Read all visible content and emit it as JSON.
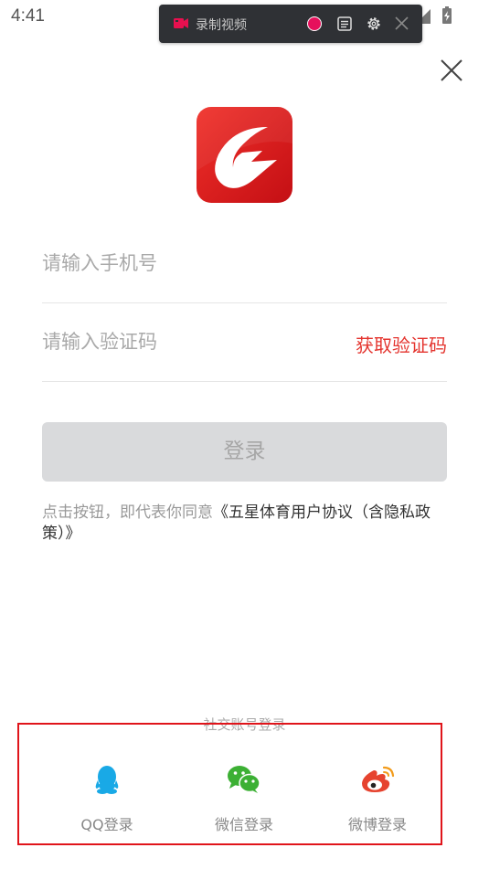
{
  "status_bar": {
    "time": "4:41"
  },
  "recorder": {
    "label": "录制视频"
  },
  "form": {
    "phone_placeholder": "请输入手机号",
    "code_placeholder": "请输入验证码",
    "get_code_label": "获取验证码",
    "login_label": "登录"
  },
  "agreement": {
    "prefix": "点击按钮，即代表你同意",
    "link": "《五星体育用户协议（含隐私政策）》"
  },
  "social": {
    "title": "社交账号登录",
    "items": [
      {
        "label": "QQ登录",
        "icon": "qq-icon",
        "color": "#19a9e6"
      },
      {
        "label": "微信登录",
        "icon": "wechat-icon",
        "color": "#3cb034"
      },
      {
        "label": "微博登录",
        "icon": "weibo-icon",
        "color": "#e6432f"
      }
    ]
  },
  "colors": {
    "accent": "#e4352f",
    "button_disabled": "#d9dadc"
  }
}
